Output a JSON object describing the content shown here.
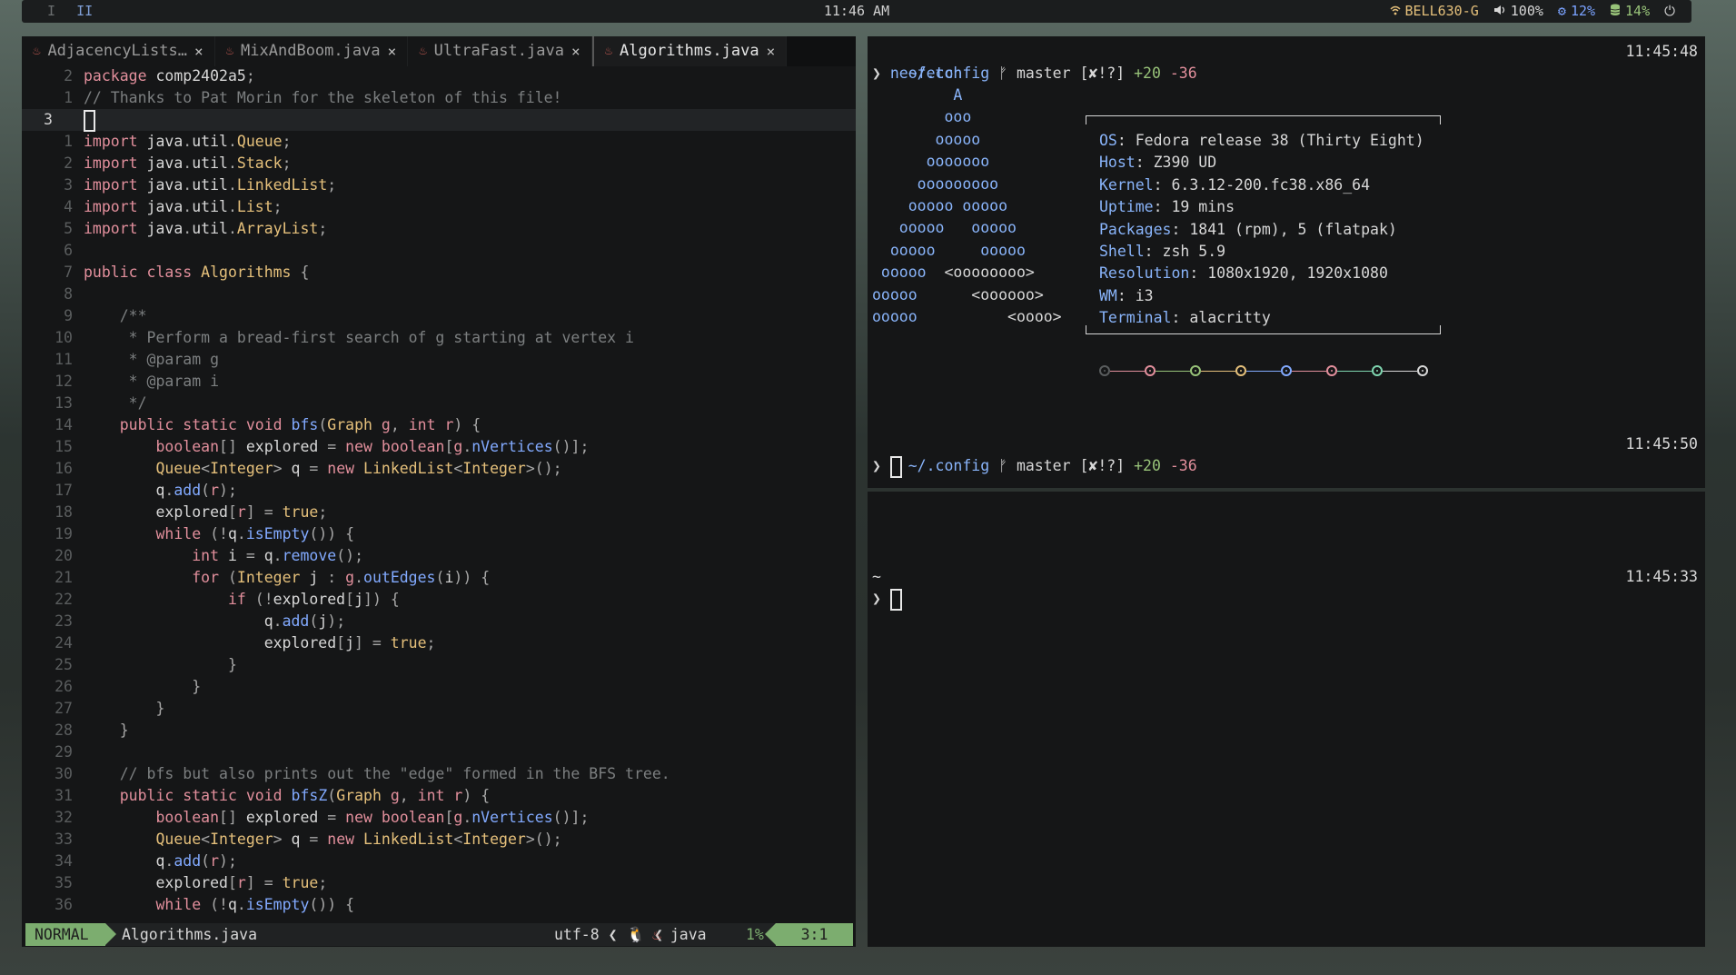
{
  "topbar": {
    "workspaces": [
      "I",
      "II"
    ],
    "clock": "11:46 AM",
    "wifi": "BELL630-G",
    "volume": "100%",
    "cpu": "12%",
    "mem": "14%"
  },
  "editor": {
    "tabs": [
      {
        "label": "AdjacencyLists…",
        "active": false
      },
      {
        "label": "MixAndBoom.java",
        "active": false
      },
      {
        "label": "UltraFast.java",
        "active": false
      },
      {
        "label": "Algorithms.java",
        "active": true
      }
    ],
    "lines": [
      {
        "n": "2",
        "code": "package comp2402a5;"
      },
      {
        "n": "1",
        "code": "// Thanks to Pat Morin for the skeleton of this file!"
      },
      {
        "n": "3",
        "code": "",
        "current": true
      },
      {
        "n": "1",
        "code": "import java.util.Queue;"
      },
      {
        "n": "2",
        "code": "import java.util.Stack;"
      },
      {
        "n": "3",
        "code": "import java.util.LinkedList;"
      },
      {
        "n": "4",
        "code": "import java.util.List;"
      },
      {
        "n": "5",
        "code": "import java.util.ArrayList;"
      },
      {
        "n": "6",
        "code": ""
      },
      {
        "n": "7",
        "code": "public class Algorithms {"
      },
      {
        "n": "8",
        "code": ""
      },
      {
        "n": "9",
        "code": "    /**"
      },
      {
        "n": "10",
        "code": "     * Perform a bread-first search of g starting at vertex i"
      },
      {
        "n": "11",
        "code": "     * @param g"
      },
      {
        "n": "12",
        "code": "     * @param i"
      },
      {
        "n": "13",
        "code": "     */"
      },
      {
        "n": "14",
        "code": "    public static void bfs(Graph g, int r) {"
      },
      {
        "n": "15",
        "code": "        boolean[] explored = new boolean[g.nVertices()];"
      },
      {
        "n": "16",
        "code": "        Queue<Integer> q = new LinkedList<Integer>();"
      },
      {
        "n": "17",
        "code": "        q.add(r);"
      },
      {
        "n": "18",
        "code": "        explored[r] = true;"
      },
      {
        "n": "19",
        "code": "        while (!q.isEmpty()) {"
      },
      {
        "n": "20",
        "code": "            int i = q.remove();"
      },
      {
        "n": "21",
        "code": "            for (Integer j : g.outEdges(i)) {"
      },
      {
        "n": "22",
        "code": "                if (!explored[j]) {"
      },
      {
        "n": "23",
        "code": "                    q.add(j);"
      },
      {
        "n": "24",
        "code": "                    explored[j] = true;"
      },
      {
        "n": "25",
        "code": "                }"
      },
      {
        "n": "26",
        "code": "            }"
      },
      {
        "n": "27",
        "code": "        }"
      },
      {
        "n": "28",
        "code": "    }"
      },
      {
        "n": "29",
        "code": ""
      },
      {
        "n": "30",
        "code": "    // bfs but also prints out the \"edge\" formed in the BFS tree."
      },
      {
        "n": "31",
        "code": "    public static void bfsZ(Graph g, int r) {"
      },
      {
        "n": "32",
        "code": "        boolean[] explored = new boolean[g.nVertices()];"
      },
      {
        "n": "33",
        "code": "        Queue<Integer> q = new LinkedList<Integer>();"
      },
      {
        "n": "34",
        "code": "        q.add(r);"
      },
      {
        "n": "35",
        "code": "        explored[r] = true;"
      },
      {
        "n": "36",
        "code": "        while (!q.isEmpty()) {"
      }
    ],
    "statusline": {
      "mode": "NORMAL",
      "filename": "Algorithms.java",
      "encoding": "utf-8",
      "filetype": "java",
      "percent": "1%",
      "position": "3:1"
    }
  },
  "terminal_top": {
    "prompt1": {
      "dir": "~/.config",
      "branch": "master",
      "status": "[✘!?]",
      "plus": "+20",
      "minus": "-36",
      "time": "11:45:48"
    },
    "command": "neofetch",
    "ascii": [
      "         A",
      "        ooo",
      "       ooooo",
      "      ooooooo",
      "     ooooooooo",
      "    ooooo ooooo",
      "   ooooo   ooooo",
      "  ooooo     ooooo",
      " ooooo  <oooooooo>",
      "ooooo      <oooooo>",
      "ooooo          <oooo>"
    ],
    "info": [
      {
        "k": "OS",
        "v": "Fedora release 38 (Thirty Eight)"
      },
      {
        "k": "Host",
        "v": "Z390 UD"
      },
      {
        "k": "Kernel",
        "v": "6.3.12-200.fc38.x86_64"
      },
      {
        "k": "Uptime",
        "v": "19 mins"
      },
      {
        "k": "Packages",
        "v": "1841 (rpm), 5 (flatpak)"
      },
      {
        "k": "Shell",
        "v": "zsh 5.9"
      },
      {
        "k": "Resolution",
        "v": "1080x1920, 1920x1080"
      },
      {
        "k": "WM",
        "v": "i3"
      },
      {
        "k": "Terminal",
        "v": "alacritty"
      }
    ],
    "palette": [
      "#5a5d5e",
      "#e28f9c",
      "#98c379",
      "#e5c07b",
      "#82aaff",
      "#e28f9c",
      "#7fd6b0",
      "#d7d7d7"
    ],
    "prompt2": {
      "dir": "~/.config",
      "branch": "master",
      "status": "[✘!?]",
      "plus": "+20",
      "minus": "-36",
      "time": "11:45:50"
    }
  },
  "terminal_bottom": {
    "dir": "~",
    "time": "11:45:33"
  }
}
